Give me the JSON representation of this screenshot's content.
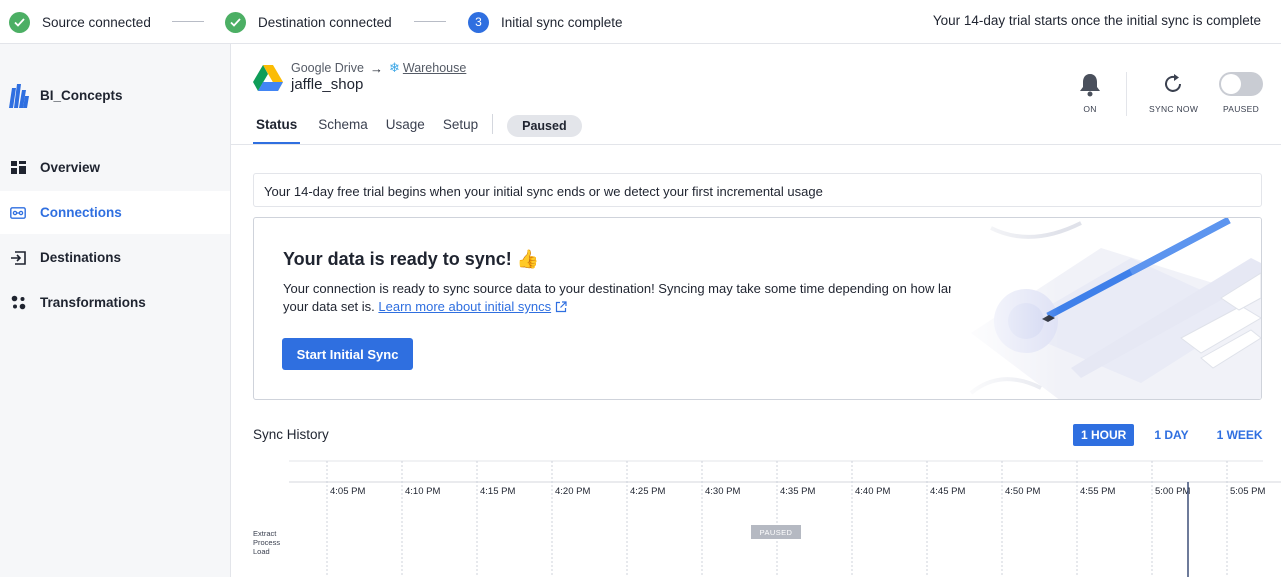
{
  "progress": {
    "steps": [
      {
        "label": "Source connected",
        "state": "done"
      },
      {
        "label": "Destination connected",
        "state": "done"
      },
      {
        "label": "Initial sync complete",
        "state": "active",
        "number": "3"
      }
    ],
    "trial_message": "Your 14-day trial starts once the initial sync is complete"
  },
  "sidebar": {
    "brand": "BI_Concepts",
    "items": [
      {
        "label": "Overview",
        "icon": "dashboard-icon"
      },
      {
        "label": "Connections",
        "icon": "connections-icon",
        "active": true
      },
      {
        "label": "Destinations",
        "icon": "destination-icon"
      },
      {
        "label": "Transformations",
        "icon": "transformations-icon"
      }
    ]
  },
  "connection": {
    "source": "Google Drive",
    "destination": "Warehouse",
    "name": "jaffle_shop"
  },
  "tabs": [
    "Status",
    "Schema",
    "Usage",
    "Setup"
  ],
  "status_pill": "Paused",
  "controls": {
    "notifications_label": "ON",
    "sync_now_label": "SYNC NOW",
    "paused_label": "PAUSED"
  },
  "trial_banner": "Your 14-day free trial begins when your initial sync ends or we detect your first incremental usage",
  "ready_card": {
    "title": "Your data is ready to sync! 👍",
    "text": "Your connection is ready to sync source data to your destination! Syncing may take some time depending on how large your data set is.",
    "link": "Learn more about initial syncs",
    "button": "Start Initial Sync"
  },
  "sync_history": {
    "title": "Sync History",
    "ranges": [
      "1 HOUR",
      "1 DAY",
      "1 WEEK"
    ],
    "active_range": "1 HOUR",
    "times": [
      "4:05 PM",
      "4:10 PM",
      "4:15 PM",
      "4:20 PM",
      "4:25 PM",
      "4:30 PM",
      "4:35 PM",
      "4:40 PM",
      "4:45 PM",
      "4:50 PM",
      "4:55 PM",
      "5:00 PM",
      "5:05 PM"
    ],
    "row_labels": [
      "Extract",
      "Process",
      "Load"
    ],
    "paused_tag": "PAUSED"
  },
  "colors": {
    "accent": "#2f6fe0",
    "success": "#4caf64",
    "sidebar_bg": "#f6f7f9"
  }
}
